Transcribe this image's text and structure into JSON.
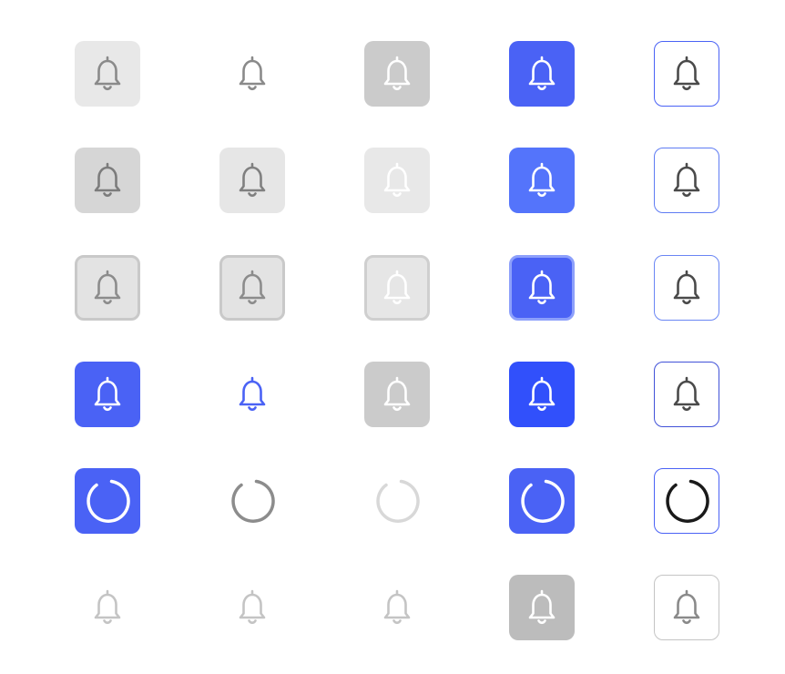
{
  "buttons": [
    {
      "row": 1,
      "col": 1,
      "icon": "bell-icon",
      "variant": "v-gray-soft",
      "state": "default"
    },
    {
      "row": 1,
      "col": 2,
      "icon": "bell-icon",
      "variant": "v-ghost",
      "state": "default"
    },
    {
      "row": 1,
      "col": 3,
      "icon": "bell-icon",
      "variant": "v-gray-mid",
      "state": "default"
    },
    {
      "row": 1,
      "col": 4,
      "icon": "bell-icon",
      "variant": "v-blue",
      "state": "default"
    },
    {
      "row": 1,
      "col": 5,
      "icon": "bell-icon",
      "variant": "v-outline",
      "state": "default"
    },
    {
      "row": 2,
      "col": 1,
      "icon": "bell-icon",
      "variant": "v-gray-hover",
      "state": "hover"
    },
    {
      "row": 2,
      "col": 2,
      "icon": "bell-icon",
      "variant": "v-gray-light",
      "state": "hover"
    },
    {
      "row": 2,
      "col": 3,
      "icon": "bell-icon",
      "variant": "v-gray-faint",
      "state": "hover"
    },
    {
      "row": 2,
      "col": 4,
      "icon": "bell-icon",
      "variant": "v-blue-hover",
      "state": "hover"
    },
    {
      "row": 2,
      "col": 5,
      "icon": "bell-icon",
      "variant": "v-outline-h",
      "state": "hover"
    },
    {
      "row": 3,
      "col": 1,
      "icon": "bell-icon",
      "variant": "v-gray-focus",
      "state": "focus"
    },
    {
      "row": 3,
      "col": 2,
      "icon": "bell-icon",
      "variant": "v-gray-focus2",
      "state": "focus"
    },
    {
      "row": 3,
      "col": 3,
      "icon": "bell-icon",
      "variant": "v-gray-focus3",
      "state": "focus"
    },
    {
      "row": 3,
      "col": 4,
      "icon": "bell-icon",
      "variant": "v-blue-focus",
      "state": "focus"
    },
    {
      "row": 3,
      "col": 5,
      "icon": "bell-icon",
      "variant": "v-outline-f",
      "state": "focus"
    },
    {
      "row": 4,
      "col": 1,
      "icon": "bell-icon",
      "variant": "v-blue-active",
      "state": "active"
    },
    {
      "row": 4,
      "col": 2,
      "icon": "bell-icon",
      "variant": "v-ghost-blue",
      "state": "active"
    },
    {
      "row": 4,
      "col": 3,
      "icon": "bell-icon",
      "variant": "v-gray-mid2",
      "state": "active"
    },
    {
      "row": 4,
      "col": 4,
      "icon": "bell-icon",
      "variant": "v-blue-deep",
      "state": "active"
    },
    {
      "row": 4,
      "col": 5,
      "icon": "bell-icon",
      "variant": "v-outline-a",
      "state": "active"
    },
    {
      "row": 5,
      "col": 1,
      "icon": "spinner-icon",
      "variant": "v-blue-load",
      "state": "loading"
    },
    {
      "row": 5,
      "col": 2,
      "icon": "spinner-icon",
      "variant": "v-ghost-load",
      "state": "loading"
    },
    {
      "row": 5,
      "col": 3,
      "icon": "spinner-icon",
      "variant": "v-ghost-loadf",
      "state": "loading"
    },
    {
      "row": 5,
      "col": 4,
      "icon": "spinner-icon",
      "variant": "v-blue-load2",
      "state": "loading"
    },
    {
      "row": 5,
      "col": 5,
      "icon": "spinner-icon",
      "variant": "v-outline-l",
      "state": "loading"
    },
    {
      "row": 6,
      "col": 1,
      "icon": "bell-icon",
      "variant": "v-ghost-dis",
      "state": "disabled"
    },
    {
      "row": 6,
      "col": 2,
      "icon": "bell-icon",
      "variant": "v-ghost-dis",
      "state": "disabled"
    },
    {
      "row": 6,
      "col": 3,
      "icon": "bell-icon",
      "variant": "v-ghost-dis",
      "state": "disabled"
    },
    {
      "row": 6,
      "col": 4,
      "icon": "bell-icon",
      "variant": "v-gray-dis",
      "state": "disabled"
    },
    {
      "row": 6,
      "col": 5,
      "icon": "bell-icon",
      "variant": "v-outline-dis",
      "state": "disabled"
    }
  ],
  "colors": {
    "primary": "#4a62f5",
    "primary_hover": "#5474fb",
    "primary_deep": "#3150fb",
    "gray_icon": "#8a8a8a",
    "disabled_icon": "#c4c4c4"
  }
}
